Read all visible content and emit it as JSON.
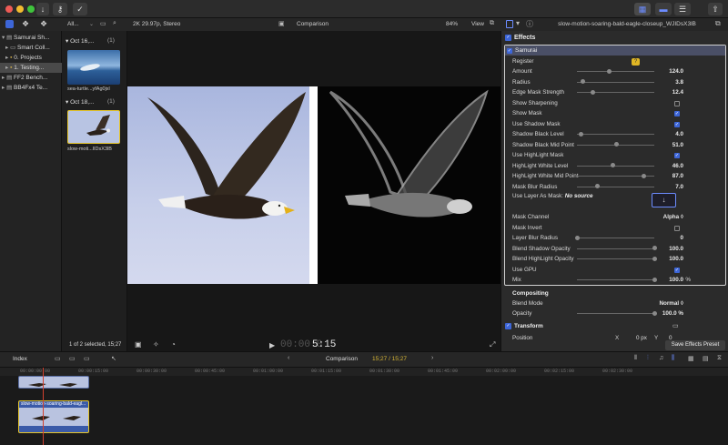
{
  "toolbar": {
    "back_label": "↓",
    "key_label": "⌐",
    "check_label": "✓"
  },
  "library": {
    "items": [
      {
        "label": "Samurai Sh..."
      },
      {
        "label": "Smart Coll..."
      },
      {
        "label": "0. Projects"
      },
      {
        "label": "1. Testing..."
      },
      {
        "label": "FF2 Bench..."
      },
      {
        "label": "BB4Fx4 Te..."
      }
    ]
  },
  "browser": {
    "filter_label": "All...",
    "groups": [
      {
        "date": "Oct 16,...",
        "count": "(1)",
        "clip": "sea-turtle...yfAg0jxl"
      },
      {
        "date": "Oct 18,...",
        "count": "(1)",
        "clip": "slow-moti...lIDsX3lB"
      }
    ],
    "status": "1 of 2 selected, 15;27"
  },
  "viewer": {
    "format": "2K 29.97p, Stereo",
    "title": "Comparison",
    "zoom": "84%",
    "view_label": "View",
    "timecode_dim": "00:00:0",
    "timecode": "5:15"
  },
  "inspector": {
    "clip_name": "slow-motion-soaring-bald-eagle-closeup_WJIDsX3lB",
    "effects_header": "Effects",
    "effect_name": "Samurai",
    "register_label": "Register",
    "rows": [
      {
        "label": "Amount",
        "value": "124.0",
        "pos": 0.42
      },
      {
        "label": "Radius",
        "value": "3.8",
        "pos": 0.08
      },
      {
        "label": "Edge Mask Strength",
        "value": "12.4",
        "pos": 0.2
      },
      {
        "label": "Show Sharpening",
        "check": false
      },
      {
        "label": "Show Mask",
        "check": true
      },
      {
        "label": "Use Shadow Mask",
        "check": true
      },
      {
        "label": "Shadow Black Level",
        "value": "4.0",
        "pos": 0.05
      },
      {
        "label": "Shadow Black Mid Point",
        "value": "51.0",
        "pos": 0.51
      },
      {
        "label": "Use HighLight Mask",
        "check": true
      },
      {
        "label": "HighLight White Level",
        "value": "46.0",
        "pos": 0.46
      },
      {
        "label": "HighLight White Mid Point",
        "value": "87.0",
        "pos": 0.87
      },
      {
        "label": "Mask Blur Radius",
        "value": "7.0",
        "pos": 0.26
      }
    ],
    "layer_mask_label": "Use Layer As Mask:",
    "layer_mask_value": "No source",
    "rows2": [
      {
        "label": "Mask Channel",
        "value": "Alpha ◊"
      },
      {
        "label": "Mask Invert",
        "check": false
      },
      {
        "label": "Layer Blur Radius",
        "value": "0",
        "pos": 0.0
      },
      {
        "label": "Blend Shadow Opacity",
        "value": "100.0",
        "pos": 1.0
      },
      {
        "label": "Blend HighLight Opacity",
        "value": "100.0",
        "pos": 1.0
      },
      {
        "label": "Use GPU",
        "check": true
      },
      {
        "label": "Mix",
        "value": "100.0",
        "unit": "%",
        "pos": 1.0
      }
    ],
    "compositing_header": "Compositing",
    "blend_mode_label": "Blend Mode",
    "blend_mode_value": "Normal ◊",
    "opacity_label": "Opacity",
    "opacity_value": "100.0 %",
    "transform_header": "Transform",
    "position_label": "Position",
    "pos_x_label": "X",
    "pos_x_value": "0 px",
    "pos_y_label": "Y",
    "pos_y_value": "0",
    "save_preset_label": "Save Effects Preset"
  },
  "timeline": {
    "index_label": "Index",
    "project_name": "Comparison",
    "duration": "15;27 / 15;27",
    "ruler": [
      "00:00:00:00",
      "00:00:15:00",
      "00:00:30:00",
      "00:00:45:00",
      "00:01:00:00",
      "00:01:15:00",
      "00:01:30:00",
      "00:01:45:00",
      "00:02:00:00",
      "00:02:15:00",
      "00:02:30:00"
    ],
    "clip_label": "slow-motion-soaring-bald-eagl..."
  },
  "colors": {
    "accent": "#3d66d8",
    "selection_yellow": "#e6c52a",
    "playhead": "#d2412f"
  }
}
